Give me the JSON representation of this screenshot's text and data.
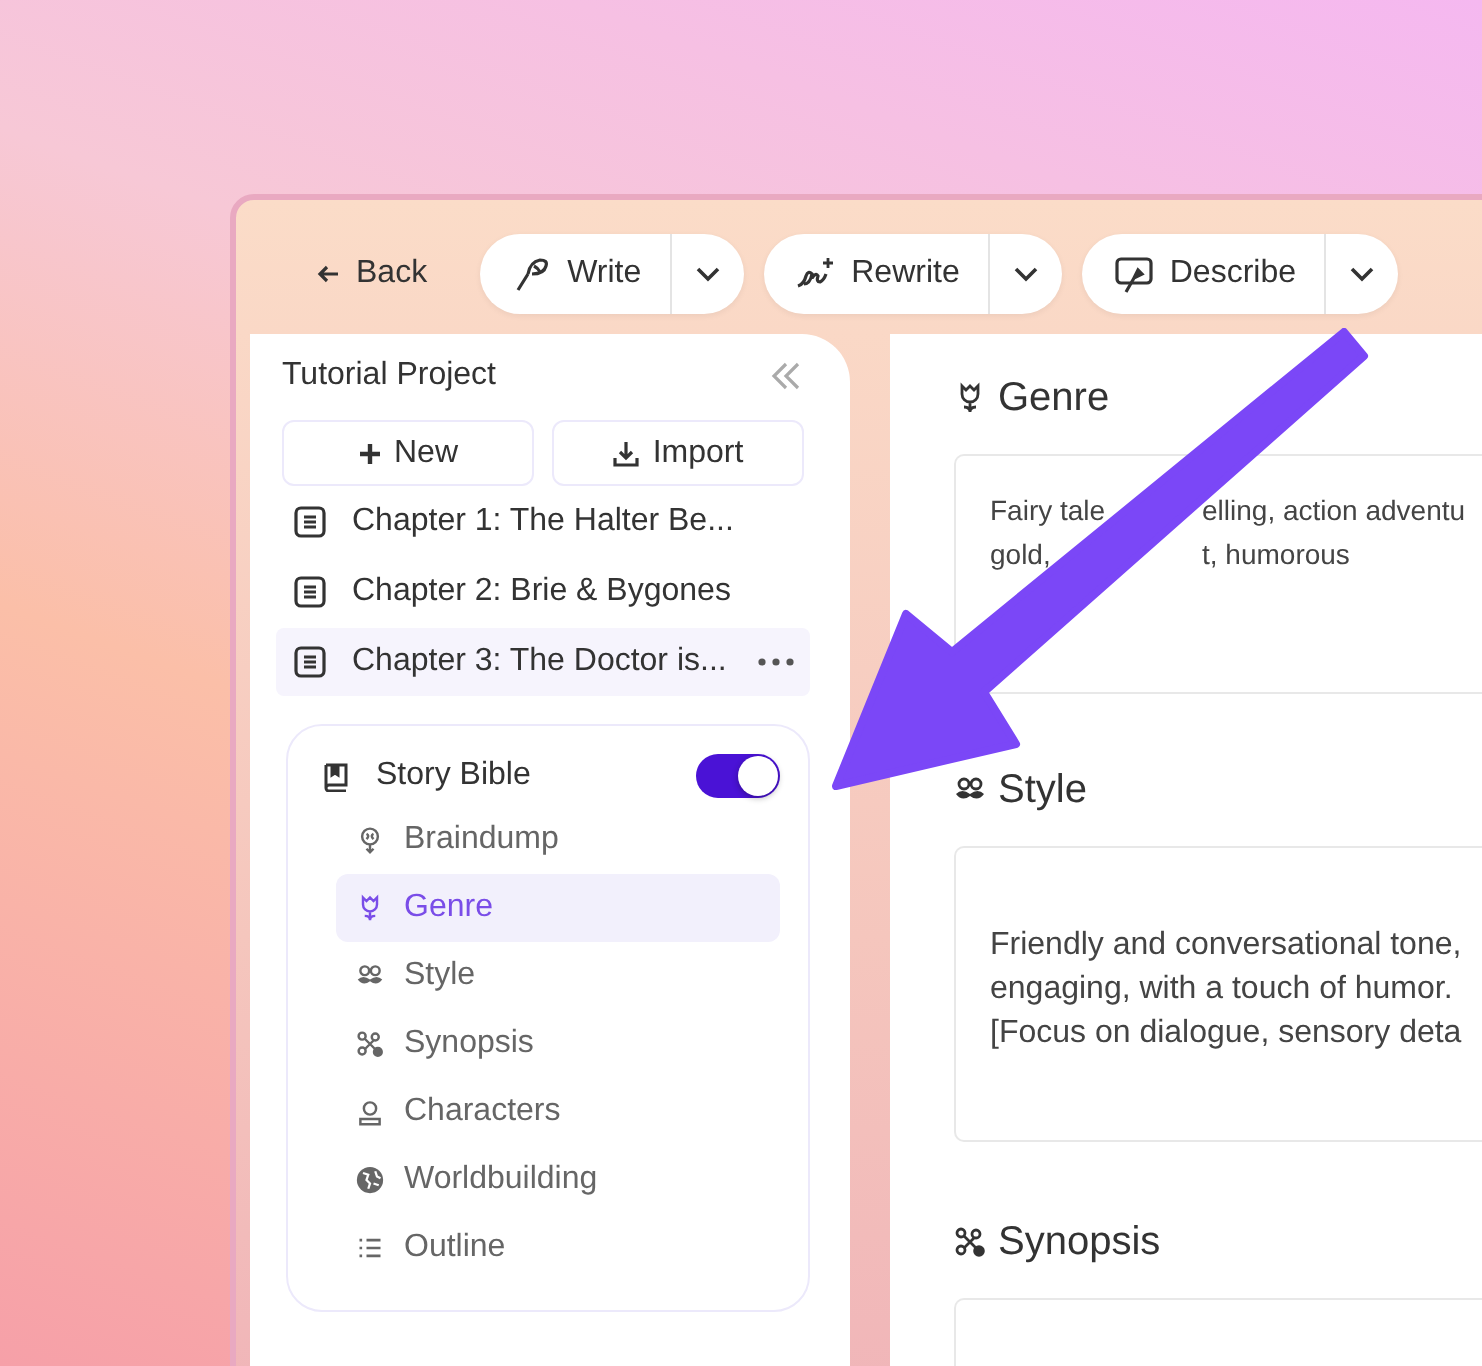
{
  "toolbar": {
    "back": {
      "label": "Back"
    },
    "actions": [
      {
        "kind": "write",
        "label": "Write"
      },
      {
        "kind": "rewrite",
        "label": "Rewrite"
      },
      {
        "kind": "describe",
        "label": "Describe"
      }
    ]
  },
  "sidebar": {
    "title": "Tutorial Project",
    "new_label": "New",
    "import_label": "Import",
    "chapters": [
      {
        "title": "Chapter 1: The Halter Be...",
        "selected": false
      },
      {
        "title": "Chapter 2: Brie & Bygones",
        "selected": false
      },
      {
        "title": "Chapter 3: The Doctor is...",
        "selected": true
      }
    ],
    "story_bible": {
      "title": "Story Bible",
      "on": true,
      "items": [
        {
          "kind": "braindump",
          "label": "Braindump",
          "selected": false
        },
        {
          "kind": "genre",
          "label": "Genre",
          "selected": true
        },
        {
          "kind": "style",
          "label": "Style",
          "selected": false
        },
        {
          "kind": "synopsis",
          "label": "Synopsis",
          "selected": false
        },
        {
          "kind": "characters",
          "label": "Characters",
          "selected": false
        },
        {
          "kind": "worldbuilding",
          "label": "Worldbuilding",
          "selected": false
        },
        {
          "kind": "outline",
          "label": "Outline",
          "selected": false
        }
      ]
    }
  },
  "sections": [
    {
      "kind": "genre",
      "title": "Genre",
      "lines": [
        "Fairy tale",
        "elling, action adventu",
        "gold,",
        "t, humorous"
      ]
    },
    {
      "kind": "style",
      "title": "Style",
      "lines": [
        "Friendly and conversational tone,",
        "engaging, with a touch of humor.",
        "[Focus on dialogue, sensory deta"
      ]
    },
    {
      "kind": "synopsis",
      "title": "Synopsis"
    }
  ]
}
